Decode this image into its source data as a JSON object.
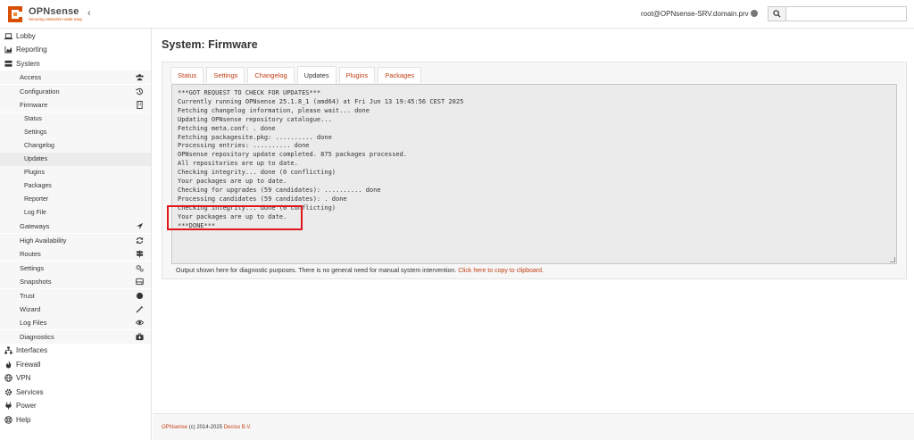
{
  "brand": {
    "name": "OPNsense",
    "tagline": "Securing networks made easy"
  },
  "header": {
    "user": "root@OPNsense-SRV.domain.prv",
    "search_placeholder": ""
  },
  "sidebar": {
    "items": [
      {
        "label": "Lobby",
        "icon": "laptop-icon"
      },
      {
        "label": "Reporting",
        "icon": "area-chart-icon"
      },
      {
        "label": "System",
        "icon": "server-icon"
      },
      {
        "label": "Access",
        "icon": "users-icon"
      },
      {
        "label": "Configuration",
        "icon": "history-icon"
      },
      {
        "label": "Firmware",
        "icon": "building-icon"
      },
      {
        "label": "Status"
      },
      {
        "label": "Settings"
      },
      {
        "label": "Changelog"
      },
      {
        "label": "Updates"
      },
      {
        "label": "Plugins"
      },
      {
        "label": "Packages"
      },
      {
        "label": "Reporter"
      },
      {
        "label": "Log File"
      },
      {
        "label": "Gateways",
        "icon": "location-arrow-icon"
      },
      {
        "label": "High Availability",
        "icon": "refresh-icon"
      },
      {
        "label": "Routes",
        "icon": "map-signs-icon"
      },
      {
        "label": "Settings",
        "icon": "cogs-icon"
      },
      {
        "label": "Snapshots",
        "icon": "hdd-icon"
      },
      {
        "label": "Trust",
        "icon": "certificate-icon"
      },
      {
        "label": "Wizard",
        "icon": "magic-icon"
      },
      {
        "label": "Log Files",
        "icon": "eye-icon"
      },
      {
        "label": "Diagnostics",
        "icon": "medkit-icon"
      },
      {
        "label": "Interfaces",
        "icon": "sitemap-icon"
      },
      {
        "label": "Firewall",
        "icon": "fire-icon"
      },
      {
        "label": "VPN",
        "icon": "globe-icon"
      },
      {
        "label": "Services",
        "icon": "cog-icon"
      },
      {
        "label": "Power",
        "icon": "plug-icon"
      },
      {
        "label": "Help",
        "icon": "life-ring-icon"
      }
    ]
  },
  "main": {
    "title": "System: Firmware",
    "tabs": [
      "Status",
      "Settings",
      "Changelog",
      "Updates",
      "Plugins",
      "Packages"
    ],
    "active_tab": "Updates",
    "console_lines": [
      "***GOT REQUEST TO CHECK FOR UPDATES***",
      "Currently running OPNsense 25.1.8_1 (amd64) at Fri Jun 13 19:45:56 CEST 2025",
      "Fetching changelog information, please wait... done",
      "Updating OPNsense repository catalogue...",
      "Fetching meta.conf: . done",
      "Fetching packagesite.pkg: .......... done",
      "Processing entries: .......... done",
      "OPNsense repository update completed. 875 packages processed.",
      "All repositories are up to date.",
      "Checking integrity... done (0 conflicting)",
      "Your packages are up to date.",
      "Checking for upgrades (59 candidates): .......... done",
      "Processing candidates (59 candidates): . done",
      "Checking integrity... done (0 conflicting)",
      "Your packages are up to date.",
      "***DONE***"
    ],
    "footnote_text": "Output shown here for diagnostic purposes. There is no general need for manual system intervention. ",
    "footnote_link": "Click here to copy to clipboard."
  },
  "footer": {
    "product": "OPNsense",
    "copyright": " (c) 2014-2025 ",
    "company": "Deciso B.V."
  },
  "colors": {
    "accent": "#d94f00",
    "link": "#c03e14",
    "highlight": "#e0161b"
  }
}
